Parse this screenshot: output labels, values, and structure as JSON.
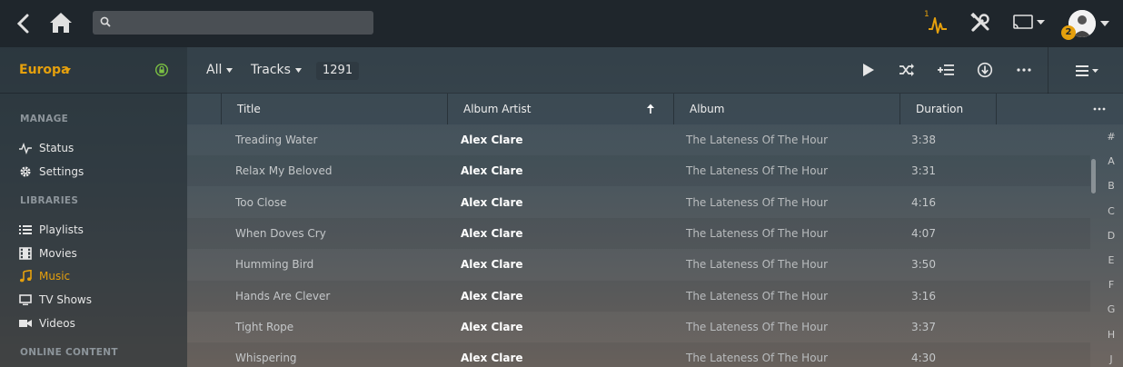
{
  "topbar": {
    "search_placeholder": "",
    "activity_count": "1",
    "notification_count": "2"
  },
  "sidebar": {
    "server_name": "Europa",
    "manage_label": "MANAGE",
    "manage_items": [
      {
        "label": "Status",
        "icon": "activity-icon"
      },
      {
        "label": "Settings",
        "icon": "gear-icon"
      }
    ],
    "libraries_label": "LIBRARIES",
    "library_items": [
      {
        "label": "Playlists",
        "icon": "list-icon"
      },
      {
        "label": "Movies",
        "icon": "film-icon"
      },
      {
        "label": "Music",
        "icon": "music-note-icon",
        "active": true
      },
      {
        "label": "TV Shows",
        "icon": "tv-icon"
      },
      {
        "label": "Videos",
        "icon": "video-camera-icon"
      }
    ],
    "online_label": "ONLINE CONTENT"
  },
  "toolbar": {
    "filter_label": "All",
    "type_label": "Tracks",
    "item_count": "1291"
  },
  "table": {
    "columns": [
      "Title",
      "Album Artist",
      "Album",
      "Duration"
    ],
    "sorted_column": "Album Artist",
    "sort_direction": "ascending",
    "rows": [
      {
        "title": "Treading Water",
        "artist": "Alex Clare",
        "album": "The Lateness Of The Hour",
        "duration": "3:38"
      },
      {
        "title": "Relax My Beloved",
        "artist": "Alex Clare",
        "album": "The Lateness Of The Hour",
        "duration": "3:31"
      },
      {
        "title": "Too Close",
        "artist": "Alex Clare",
        "album": "The Lateness Of The Hour",
        "duration": "4:16"
      },
      {
        "title": "When Doves Cry",
        "artist": "Alex Clare",
        "album": "The Lateness Of The Hour",
        "duration": "4:07"
      },
      {
        "title": "Humming Bird",
        "artist": "Alex Clare",
        "album": "The Lateness Of The Hour",
        "duration": "3:50"
      },
      {
        "title": "Hands Are Clever",
        "artist": "Alex Clare",
        "album": "The Lateness Of The Hour",
        "duration": "3:16"
      },
      {
        "title": "Tight Rope",
        "artist": "Alex Clare",
        "album": "The Lateness Of The Hour",
        "duration": "3:37"
      },
      {
        "title": "Whispering",
        "artist": "Alex Clare",
        "album": "The Lateness Of The Hour",
        "duration": "4:30"
      }
    ]
  },
  "jump_bar": [
    "#",
    "A",
    "B",
    "C",
    "D",
    "E",
    "F",
    "G",
    "H",
    "J"
  ],
  "colors": {
    "accent": "#e5a00d",
    "topbar_bg": "#1f262c",
    "lock_green": "#7bc043"
  }
}
